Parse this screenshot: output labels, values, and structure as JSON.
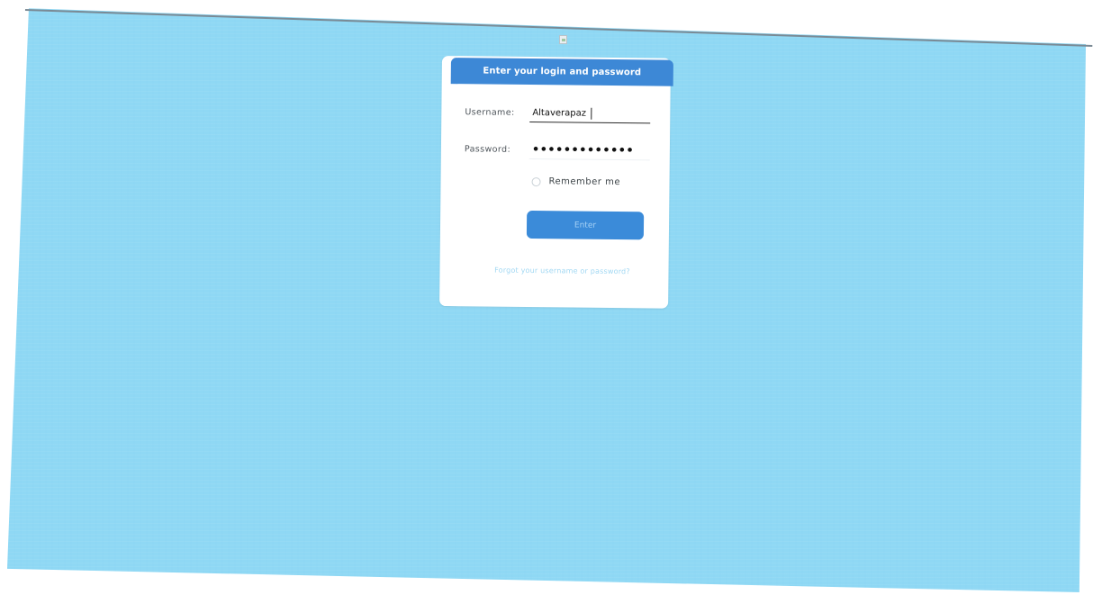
{
  "colors": {
    "background": "#8fd8f4",
    "card": "#ffffff",
    "header": "#3d88d6",
    "button": "#3b8bd9",
    "link": "#a2d8f3"
  },
  "header": {
    "title": "Enter your login and password"
  },
  "form": {
    "username_label": "Username:",
    "username_value": "Altaverapaz",
    "password_label": "Password:",
    "password_value": "•••••••••••••",
    "remember_label": "Remember me",
    "remember_checked": false,
    "submit_label": "Enter",
    "forgot_link": "Forgot your username or password?"
  },
  "icons": {
    "logo": "broken-image-icon",
    "remember": "radio-circle-icon"
  }
}
